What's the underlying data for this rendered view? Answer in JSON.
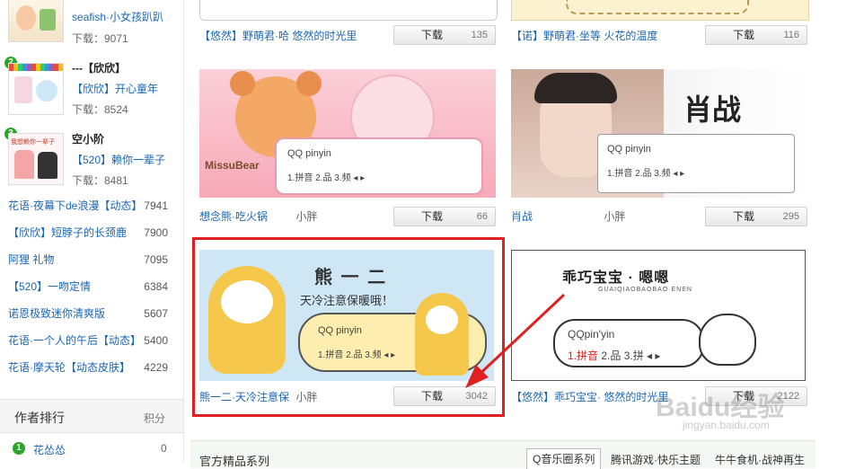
{
  "sidebar": {
    "top_items": [
      {
        "rank": "",
        "title": "seafish·小女孩趴趴",
        "downloads": "下载：9071"
      },
      {
        "rank": "2",
        "author": "---【欣欣】",
        "title": "【欣欣】开心童年",
        "downloads": "下载：8524"
      },
      {
        "rank": "3",
        "author": "空小阶",
        "title": "【520】赖你一辈子",
        "downloads": "下载：8481"
      }
    ],
    "thumb_text_3": "我想赖你一辈子",
    "ranking": [
      {
        "title": "花语·夜幕下de浪漫【动态】",
        "count": "7941"
      },
      {
        "title": "【欣欣】短脖子的长颈鹿",
        "count": "7900"
      },
      {
        "title": "阿狸 礼物",
        "count": "7095"
      },
      {
        "title": "【520】一吻定情",
        "count": "6384"
      },
      {
        "title": "诺恩极致迷你清爽版",
        "count": "5607"
      },
      {
        "title": "花语·一个人的午后【动态】",
        "count": "5400"
      },
      {
        "title": "花语·摩天轮【动态皮肤】",
        "count": "4229"
      }
    ],
    "author_rank": {
      "title": "作者排行",
      "label": "积分",
      "first": {
        "rank": "1",
        "name": "花怂怂",
        "score": "0"
      }
    }
  },
  "cards": [
    {
      "caption_tag": "【悠然】",
      "caption": "野萌君·哈 悠然的时光里",
      "author": "",
      "dl_label": "下载",
      "count": "135"
    },
    {
      "caption_tag": "【诺】",
      "caption": "野萌君·坐等 火花的温度",
      "author": "",
      "dl_label": "下载",
      "count": "116"
    },
    {
      "caption_tag": "",
      "caption": "想念熊·吃火锅",
      "author": "小胖",
      "dl_label": "下载",
      "count": "66",
      "img_brand": "MissuBear",
      "qq": "QQ pinyin",
      "line": "1.拼音 2.品 3.频 ◂ ▸"
    },
    {
      "caption_tag": "",
      "caption": "肖战",
      "author": "小胖",
      "dl_label": "下载",
      "count": "295",
      "img_title": "肖战",
      "qq": "QQ pinyin",
      "line": "1.拼音 2.品 3.频 ◂ ▸"
    },
    {
      "caption_tag": "",
      "caption": "熊一二·天冷注意保",
      "author": "小胖",
      "dl_label": "下载",
      "count": "3042",
      "img_title": "熊 一 二",
      "img_sub": "天冷注意保暖哦！",
      "qq": "QQ pinyin",
      "line": "1.拼音 2.品 3.频 ◂ ▸"
    },
    {
      "caption_tag": "【悠然】",
      "caption": "乖巧宝宝· 悠然的时光里",
      "author": "",
      "dl_label": "下载",
      "count": "2122",
      "img_title": "乖巧宝宝 · 嗯嗯",
      "img_sub": "GUAIQIAOBAOBAO·ENEN",
      "qq": "QQpin'yin",
      "line_a": "1.拼音",
      "line_b": "2.品 3.拼 ◂ ▸"
    }
  ],
  "bottom_bar": {
    "title": "官方精品系列",
    "tabs": [
      "Q音乐圈系列",
      "腾讯游戏·快乐主题",
      "牛牛食机·战神再生"
    ]
  },
  "watermark": {
    "main": "Baidu经验",
    "url": "jingyan.baidu.com"
  },
  "colors": {
    "link": "#1a66b3",
    "highlight": "#e02020",
    "badge": "#2aa52a",
    "arrow": "#2aa52a"
  }
}
